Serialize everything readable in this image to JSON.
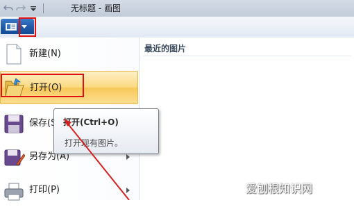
{
  "title_bar": {
    "title": "无标题 - 画图",
    "quick_access": [
      "undo-icon",
      "redo-icon",
      "customize-dropdown-icon"
    ]
  },
  "ribbon": {
    "file_button_icon": "paint-menu-icon"
  },
  "menu": {
    "items": [
      {
        "label": "新建(N)",
        "icon": "new-document-icon",
        "has_submenu": false
      },
      {
        "label": "打开(O)",
        "icon": "open-folder-icon",
        "has_submenu": false,
        "state": "hover"
      },
      {
        "label": "保存(S)",
        "icon": "save-disk-icon",
        "has_submenu": false
      },
      {
        "label": "另存为(A)",
        "icon": "save-as-icon",
        "has_submenu": true
      },
      {
        "label": "打印(P)",
        "icon": "printer-icon",
        "has_submenu": true
      }
    ]
  },
  "recent": {
    "header": "最近的图片"
  },
  "tooltip": {
    "title": "打开(Ctrl+O)",
    "description": "打开现有图片。"
  },
  "watermark": "爱刨根知识网",
  "colors": {
    "highlight_red": "#e01010",
    "hover_gold": "#f8c85a",
    "file_button_blue": "#1e5aa8"
  }
}
